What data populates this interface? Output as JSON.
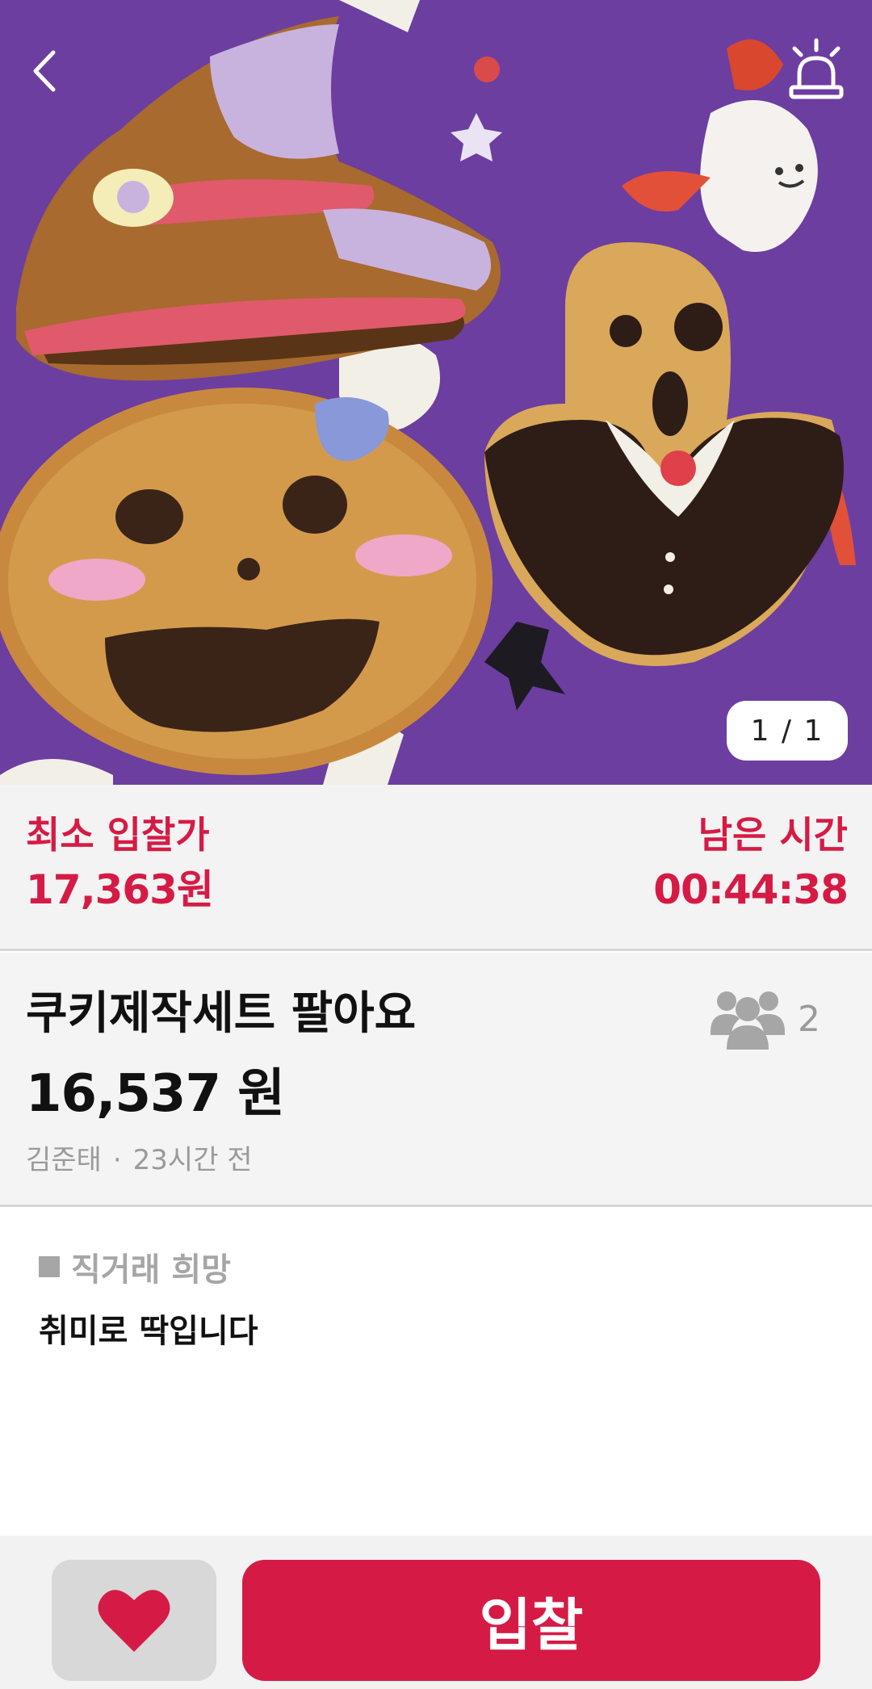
{
  "hero": {
    "image_description_icon": "product-photo",
    "counter": "1 / 1"
  },
  "nav": {
    "back_icon": "chevron-left-icon",
    "report_icon": "siren-icon"
  },
  "bid": {
    "min_label": "최소 입찰가",
    "min_value": "17,363원",
    "time_label": "남은 시간",
    "time_value": "00:44:38"
  },
  "item": {
    "title": "쿠키제작세트 팔아요",
    "price": "16,537 원",
    "seller": "김준태",
    "posted": "23시간 전",
    "bidders_icon": "people-icon",
    "bidders_count": "2"
  },
  "description": {
    "trade_type": "직거래 희망",
    "text": "취미로 딱입니다"
  },
  "actions": {
    "like_icon": "heart-icon",
    "bid_label": "입찰"
  },
  "colors": {
    "accent": "#d51b45",
    "muted": "#9a9a9a",
    "hero_background": "#6b3f9c"
  }
}
